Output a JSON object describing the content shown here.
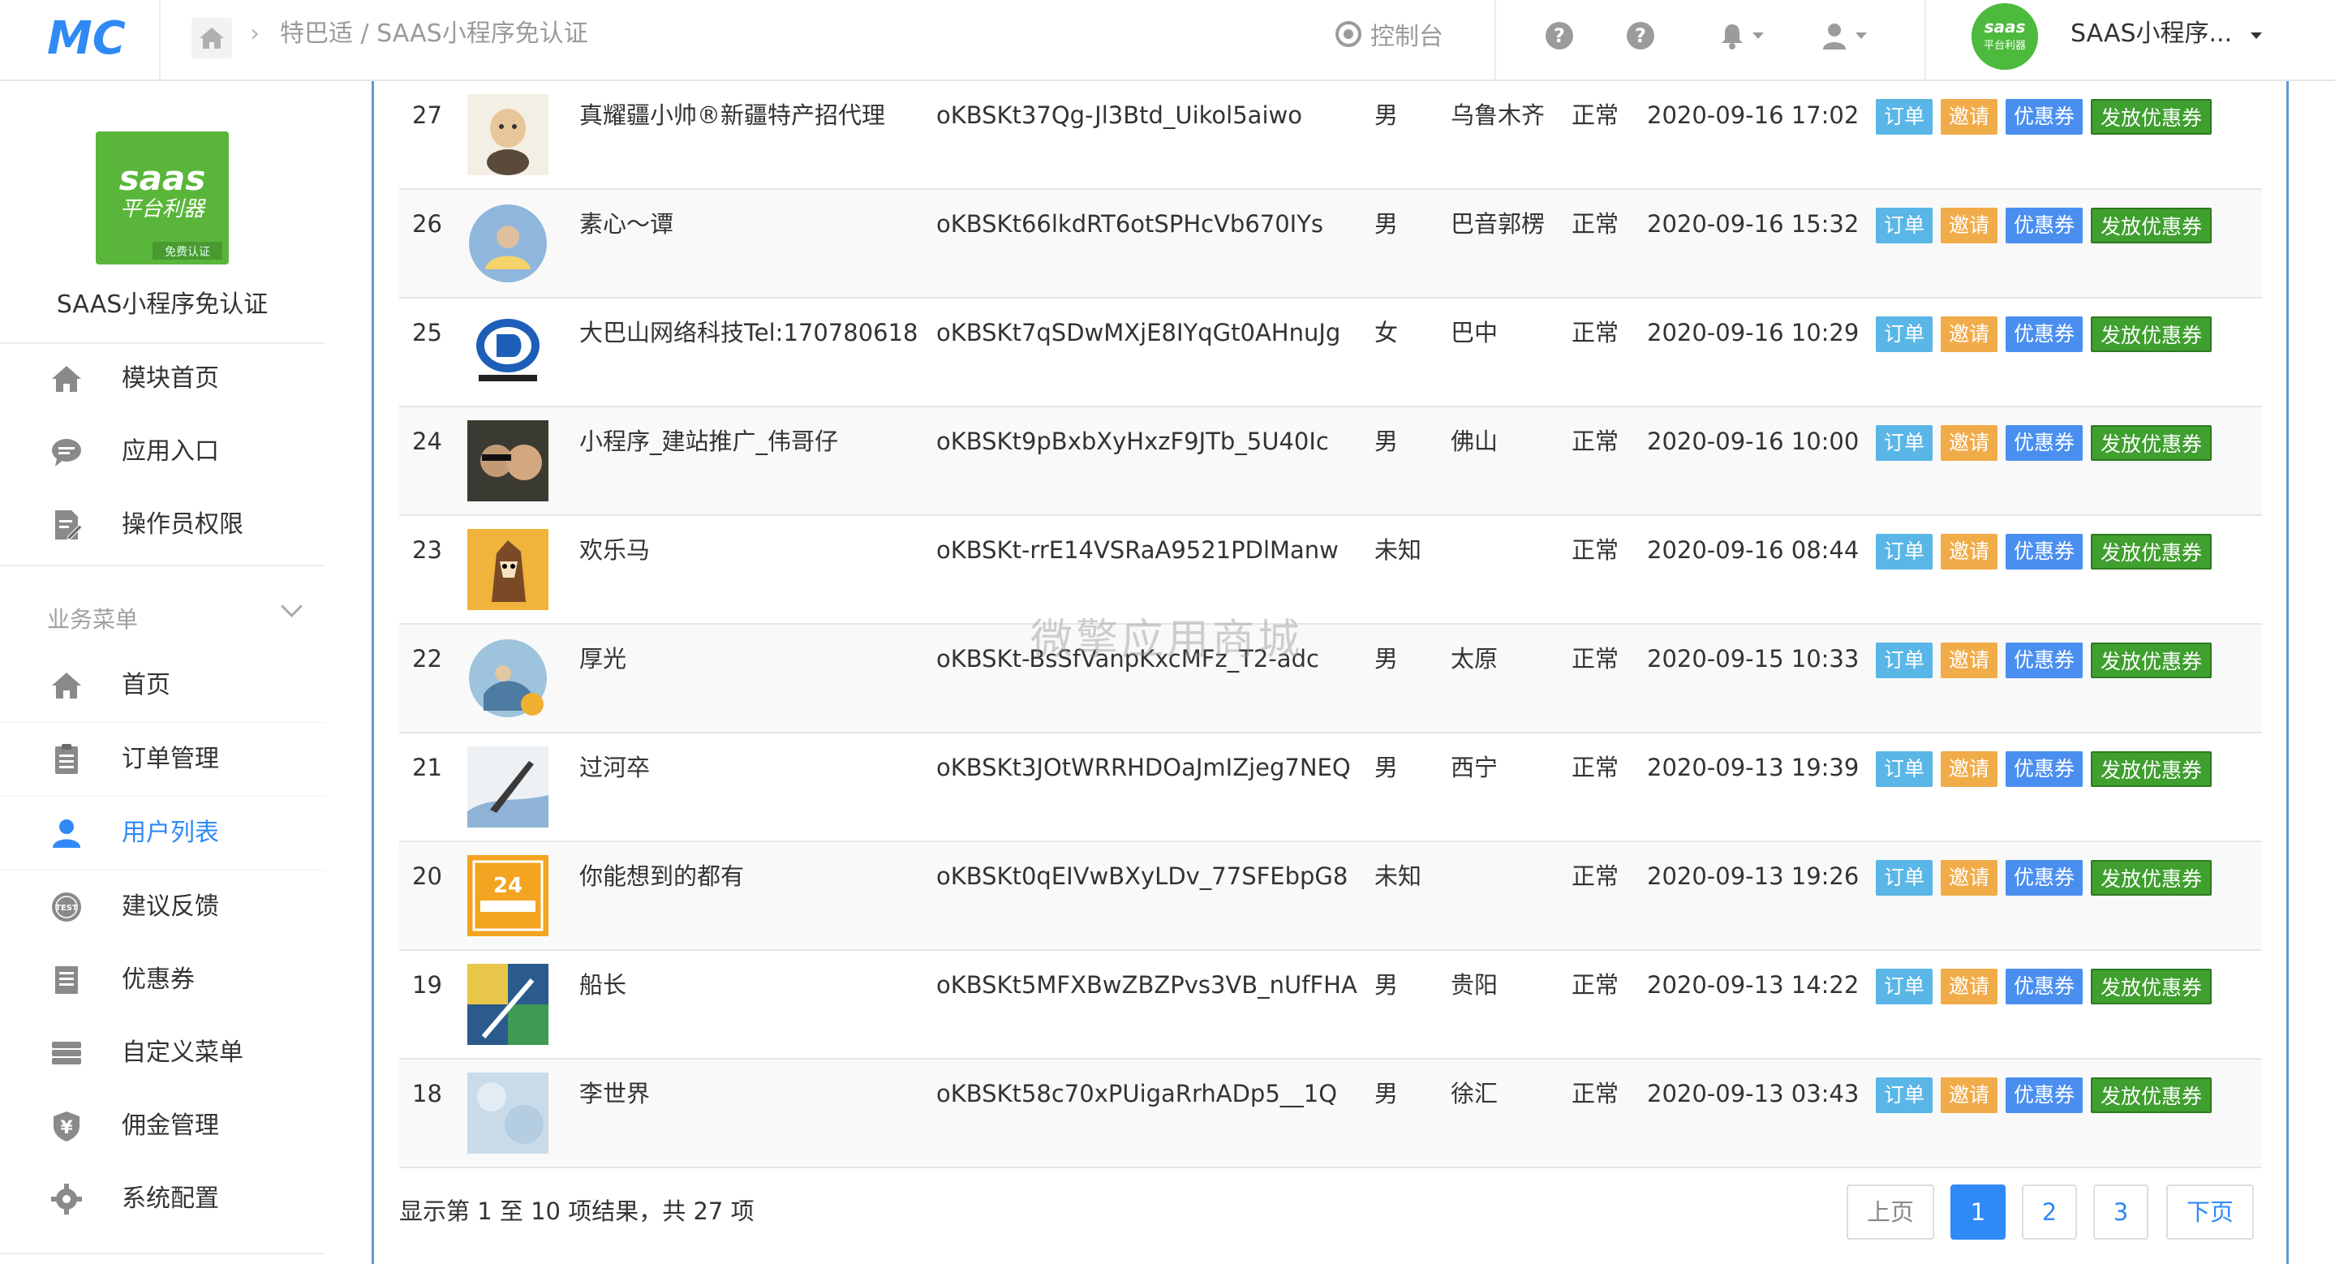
{
  "header": {
    "logo_text": "MC",
    "breadcrumb": "特巴适 / SAAS小程序免认证",
    "console_label": "控制台",
    "user_name": "SAAS小程序..."
  },
  "sidebar": {
    "app_name": "SAAS小程序免认证",
    "logo_text": "saas",
    "logo_sub": "平台利器",
    "logo_tag": "免费认证",
    "top_items": [
      {
        "label": "模块首页",
        "icon": "home-icon"
      },
      {
        "label": "应用入口",
        "icon": "chat-icon"
      },
      {
        "label": "操作员权限",
        "icon": "document-edit-icon"
      }
    ],
    "section_label": "业务菜单",
    "biz_items": [
      {
        "label": "首页",
        "icon": "home-icon"
      },
      {
        "label": "订单管理",
        "icon": "clipboard-icon"
      },
      {
        "label": "用户列表",
        "icon": "user-icon",
        "active": true
      },
      {
        "label": "建议反馈",
        "icon": "test-badge-icon"
      },
      {
        "label": "优惠券",
        "icon": "list-icon"
      },
      {
        "label": "自定义菜单",
        "icon": "card-stack-icon"
      },
      {
        "label": "佣金管理",
        "icon": "yen-shield-icon"
      },
      {
        "label": "系统配置",
        "icon": "gear-icon"
      }
    ]
  },
  "buttons": {
    "order": "订单",
    "invite": "邀请",
    "coupon": "优惠券",
    "send_coupon": "发放优惠券"
  },
  "rows": [
    {
      "id": "27",
      "name": "真耀疆小帅®新疆特产招代理",
      "openid": "oKBSKt37Qg-Jl3Btd_Uikol5aiwo",
      "sex": "男",
      "city": "乌鲁木齐",
      "status": "正常",
      "time": "2020-09-16 17:02"
    },
    {
      "id": "26",
      "name": "素心～谭",
      "openid": "oKBSKt66lkdRT6otSPHcVb670IYs",
      "sex": "男",
      "city": "巴音郭楞",
      "status": "正常",
      "time": "2020-09-16 15:32"
    },
    {
      "id": "25",
      "name": "大巴山网络科技Tel:170780618",
      "openid": "oKBSKt7qSDwMXjE8IYqGt0AHnuJg",
      "sex": "女",
      "city": "巴中",
      "status": "正常",
      "time": "2020-09-16 10:29"
    },
    {
      "id": "24",
      "name": "小程序_建站推广_伟哥仔",
      "openid": "oKBSKt9pBxbXyHxzF9JTb_5U40Ic",
      "sex": "男",
      "city": "佛山",
      "status": "正常",
      "time": "2020-09-16 10:00"
    },
    {
      "id": "23",
      "name": "欢乐马",
      "openid": "oKBSKt-rrE14VSRaA9521PDlManw",
      "sex": "未知",
      "city": "",
      "status": "正常",
      "time": "2020-09-16 08:44"
    },
    {
      "id": "22",
      "name": "厚光",
      "openid": "oKBSKt-BsSfVanpKxcMFz_T2-adc",
      "sex": "男",
      "city": "太原",
      "status": "正常",
      "time": "2020-09-15 10:33"
    },
    {
      "id": "21",
      "name": "过河卒",
      "openid": "oKBSKt3JOtWRRHDOaJmIZjeg7NEQ",
      "sex": "男",
      "city": "西宁",
      "status": "正常",
      "time": "2020-09-13 19:39"
    },
    {
      "id": "20",
      "name": "你能想到的都有",
      "openid": "oKBSKt0qEIVwBXyLDv_77SFEbpG8",
      "sex": "未知",
      "city": "",
      "status": "正常",
      "time": "2020-09-13 19:26"
    },
    {
      "id": "19",
      "name": "船长",
      "openid": "oKBSKt5MFXBwZBZPvs3VB_nUfFHA",
      "sex": "男",
      "city": "贵阳",
      "status": "正常",
      "time": "2020-09-13 14:22"
    },
    {
      "id": "18",
      "name": "李世界",
      "openid": "oKBSKt58c70xPUigaRrhADp5__1Q",
      "sex": "男",
      "city": "徐汇",
      "status": "正常",
      "time": "2020-09-13 03:43"
    }
  ],
  "footer": {
    "summary": "显示第 1 至 10 项结果，共 27 项"
  },
  "pagination": {
    "prev": "上页",
    "pages": [
      "1",
      "2",
      "3"
    ],
    "current": "1",
    "next": "下页"
  },
  "watermark": "微擎应用商城"
}
